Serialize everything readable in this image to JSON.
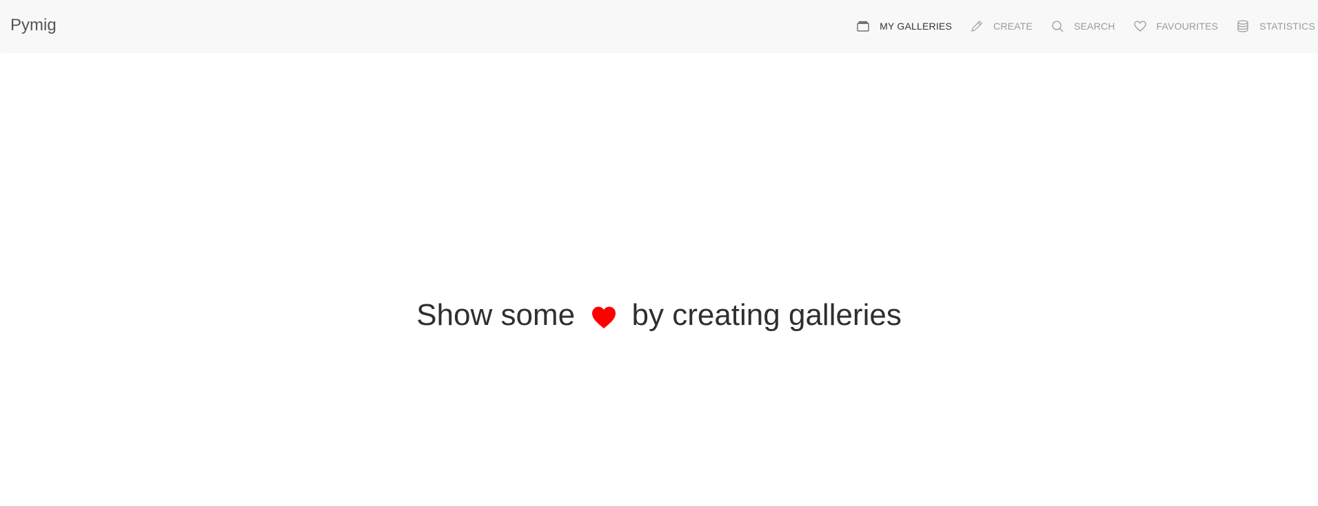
{
  "app": {
    "brand": "Pymig"
  },
  "nav": {
    "items": [
      {
        "label": "MY GALLERIES",
        "icon": "galleries-icon",
        "active": true
      },
      {
        "label": "CREATE",
        "icon": "pencil-icon",
        "active": false
      },
      {
        "label": "SEARCH",
        "icon": "search-icon",
        "active": false
      },
      {
        "label": "FAVOURITES",
        "icon": "heart-outline-icon",
        "active": false
      },
      {
        "label": "STATISTICS",
        "icon": "database-icon",
        "active": false
      }
    ]
  },
  "main": {
    "message_before": "Show some",
    "message_icon": "heart-icon",
    "message_after": "by creating galleries"
  },
  "colors": {
    "topbar_bg": "#f8f8f8",
    "nav_active": "#333333",
    "nav_inactive": "#9a9a9a",
    "heart": "#ff0000",
    "message_text": "#2f2f2f"
  }
}
